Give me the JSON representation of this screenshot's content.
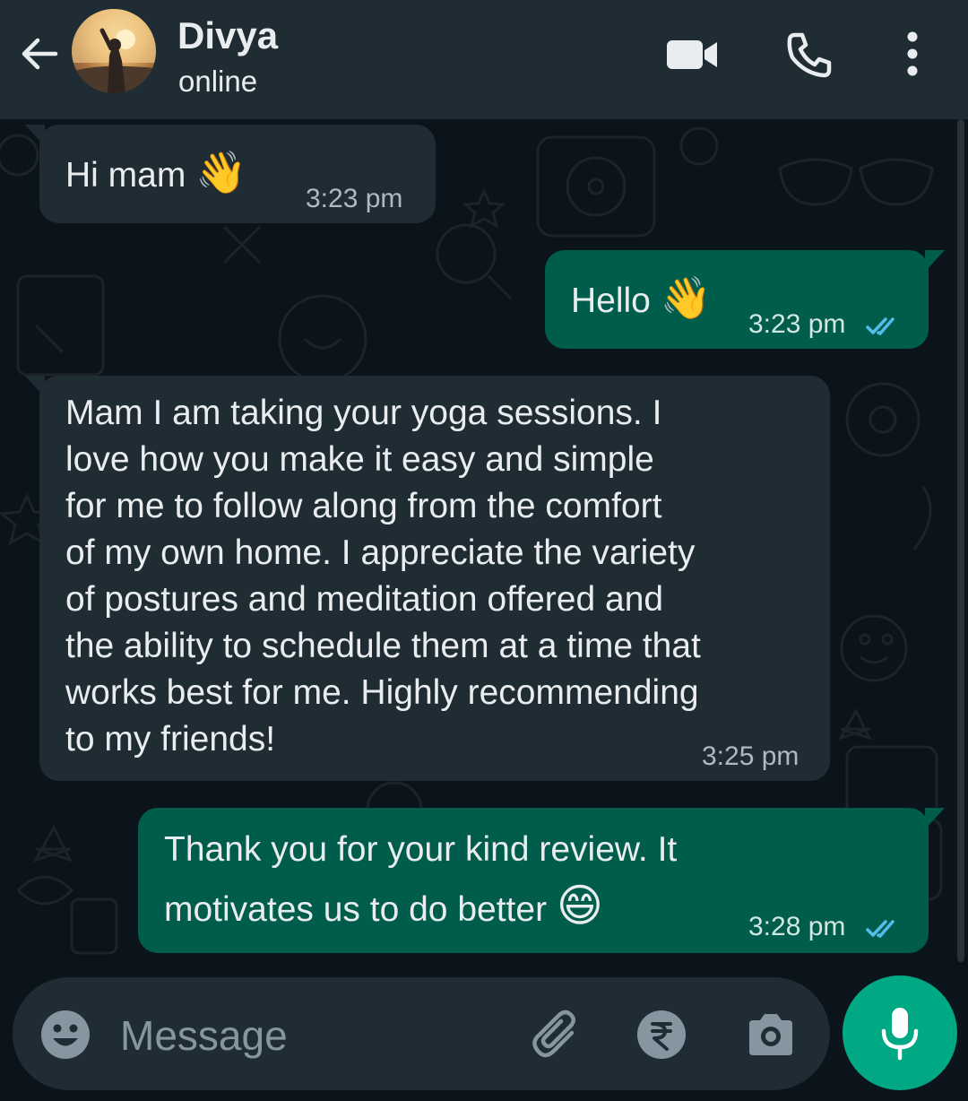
{
  "header": {
    "contact_name": "Divya",
    "status": "online",
    "icons": [
      "back-arrow-icon",
      "avatar",
      "video-call-icon",
      "phone-call-icon",
      "more-options-icon"
    ]
  },
  "messages": [
    {
      "direction": "incoming",
      "text_lines": [
        "Hi mam"
      ],
      "emoji": "👋",
      "time": "3:23 pm"
    },
    {
      "direction": "outgoing",
      "text_lines": [
        "Hello"
      ],
      "emoji": "👋",
      "time": "3:23 pm",
      "status": "read"
    },
    {
      "direction": "incoming",
      "text_lines": [
        "Mam I am taking your yoga sessions. I",
        "love how you make it easy and simple",
        "for me to follow along from the comfort",
        "of my own home. I appreciate the variety",
        "of postures and meditation offered and",
        "the ability to schedule them at a time that",
        "works best for me. Highly recommending",
        "to my friends!"
      ],
      "time": "3:25 pm"
    },
    {
      "direction": "outgoing",
      "text_lines": [
        "Thank you for your kind review. It",
        "motivates us to do better"
      ],
      "emoji": "😄",
      "time": "3:28 pm",
      "status": "read"
    }
  ],
  "input": {
    "placeholder": "Message",
    "icons": [
      "emoji-icon",
      "attach-icon",
      "rupee-payment-icon",
      "camera-icon",
      "mic-icon"
    ]
  },
  "colors": {
    "header_bg": "#1f2c34",
    "chat_bg": "#0b141a",
    "incoming_bubble": "#1f2c34",
    "outgoing_bubble": "#005c4b",
    "read_ticks": "#53bdeb",
    "mic_button": "#00a884"
  }
}
